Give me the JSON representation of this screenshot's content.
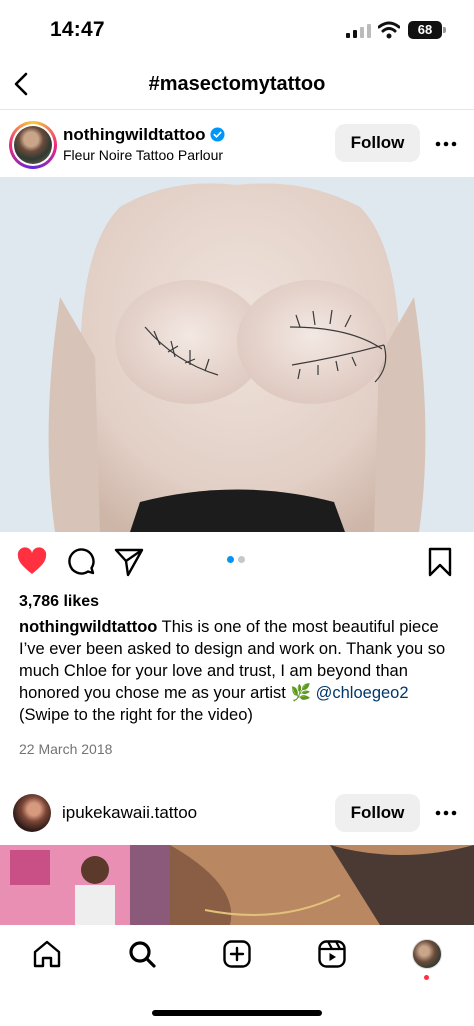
{
  "status_bar": {
    "time": "14:47",
    "battery": "68"
  },
  "header": {
    "title": "#masectomytattoo",
    "back_icon": "chevron-left-icon"
  },
  "post": {
    "username": "nothingwildtattoo",
    "verified": true,
    "location": "Fleur Noire Tattoo Parlour",
    "follow_label": "Follow",
    "image_description_icon": "post-photo",
    "carousel": {
      "count": 2,
      "active": 1
    },
    "likes": "3,786 likes",
    "caption_user": "nothingwildtattoo",
    "caption_text": "This is one of the most beautiful piece I’ve ever been asked to design and work on. Thank you so much Chloe for your love and trust, I am beyond than honored you chose me as your artist 🌿",
    "caption_mention": "@chloegeo2",
    "caption_swipe": "(Swipe to the right for the video)",
    "date": "22 March 2018"
  },
  "post2": {
    "username": "ipukekawaii.tattoo",
    "follow_label": "Follow"
  },
  "colors": {
    "like_red": "#ff3040",
    "accent_blue": "#0095f6",
    "mention_blue": "#00376b",
    "follow_bg": "#efefef"
  },
  "tabs": [
    "home-icon",
    "search-icon",
    "create-icon",
    "reels-icon",
    "profile-avatar"
  ]
}
